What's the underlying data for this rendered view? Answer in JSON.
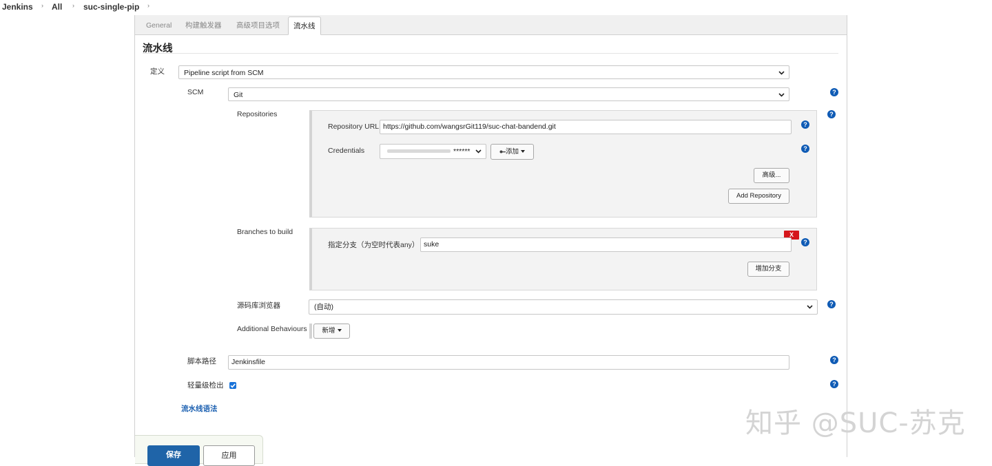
{
  "breadcrumb": [
    "Jenkins",
    "All",
    "suc-single-pip"
  ],
  "tabs": [
    "General",
    "构建触发器",
    "高级项目选项",
    "流水线"
  ],
  "active_tab": "流水线",
  "section_title": "流水线",
  "definition": {
    "label": "定义",
    "value": "Pipeline script from SCM"
  },
  "scm": {
    "label": "SCM",
    "value": "Git"
  },
  "repositories": {
    "label": "Repositories",
    "url_label": "Repository URL",
    "url_value": "https://github.com/wangsrGit119/suc-chat-bandend.git",
    "credentials_label": "Credentials",
    "credentials_value": "******",
    "add_label": "添加",
    "advanced_label": "高级...",
    "add_repo_label": "Add Repository"
  },
  "branches": {
    "label": "Branches to build",
    "delete_label": "X",
    "spec_label": "指定分支（为空时代表any）",
    "spec_value": "suke",
    "add_branch_label": "增加分支"
  },
  "browser": {
    "label": "源码库浏览器",
    "value": "(自动)"
  },
  "behaviours": {
    "label": "Additional Behaviours",
    "add_label": "新增"
  },
  "script_path": {
    "label": "脚本路径",
    "value": "Jenkinsfile"
  },
  "lightweight": {
    "label": "轻量级检出",
    "checked": true
  },
  "syntax_link": "流水线语法",
  "buttons": {
    "save": "保存",
    "apply": "应用"
  },
  "watermark": "知乎 @SUC-苏克",
  "colors": {
    "help": "#0f5bb5",
    "save": "#1f64a8",
    "delete": "#d5161b",
    "link": "#1a5fb0"
  }
}
